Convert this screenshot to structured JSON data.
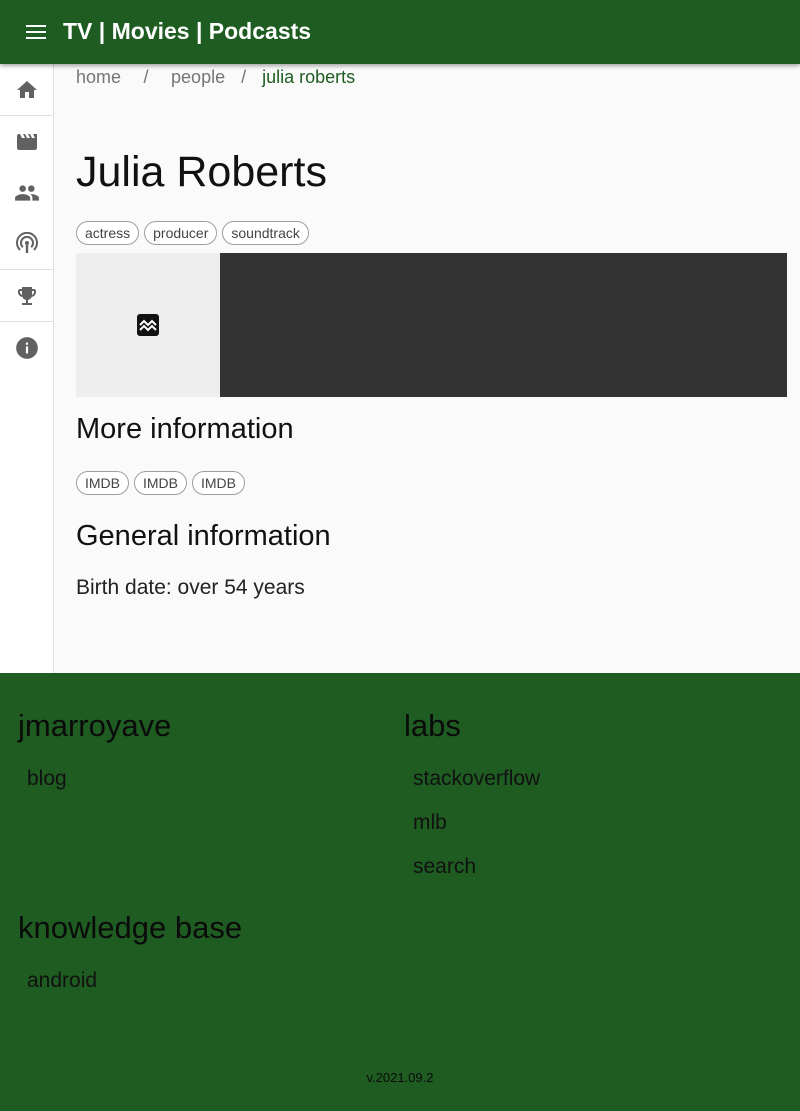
{
  "app": {
    "title": "TV | Movies | Podcasts",
    "bar_color": "#1e5c21"
  },
  "rail": {
    "items": [
      {
        "icon": "home-icon"
      },
      {
        "icon": "movie-icon"
      },
      {
        "icon": "people-icon"
      },
      {
        "icon": "podcast-icon"
      },
      {
        "icon": "trophy-icon"
      },
      {
        "icon": "info-icon"
      }
    ]
  },
  "breadcrumb": {
    "home": "home",
    "sep": "/",
    "people": "people",
    "current": "julia roberts"
  },
  "person": {
    "name": "Julia Roberts",
    "roles": [
      "actress",
      "producer",
      "soundtrack"
    ],
    "image_icon": "broken-image-icon"
  },
  "more_info": {
    "title": "More information",
    "links": [
      "IMDB",
      "IMDB",
      "IMDB"
    ]
  },
  "general_info": {
    "title": "General information",
    "birth": "Birth date: over 54 years"
  },
  "footer": {
    "col1": {
      "title": "jmarroyave",
      "links": [
        "blog"
      ]
    },
    "col2": {
      "title": "labs",
      "links": [
        "stackoverflow",
        "mlb",
        "search"
      ]
    },
    "col3": {
      "title": "knowledge base",
      "links": [
        "android"
      ]
    },
    "version": "v.2021.09.2"
  }
}
